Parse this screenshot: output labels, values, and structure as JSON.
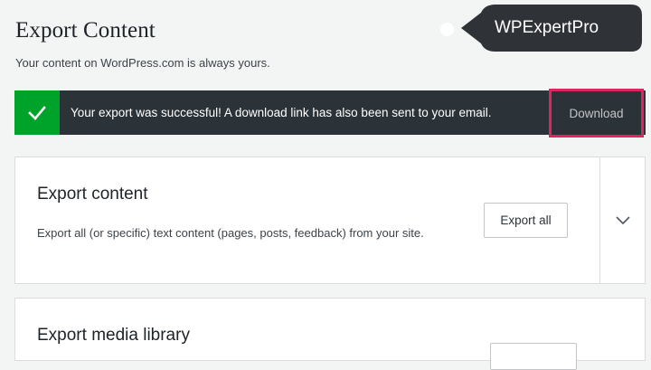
{
  "header": {
    "title": "Export Content",
    "subtitle": "Your content on WordPress.com is always yours."
  },
  "watermark": {
    "text": "WPExpertPro"
  },
  "notice": {
    "status": "success",
    "icon": "checkmark-icon",
    "message": "Your export was successful! A download link has also been sent to your email.",
    "action_label": "Download"
  },
  "cards": [
    {
      "title": "Export content",
      "description": "Export all (or specific) text content (pages, posts, feedback) from your site.",
      "button_label": "Export all",
      "toggle_icon": "chevron-down-icon"
    },
    {
      "title": "Export media library"
    }
  ],
  "colors": {
    "success": "#00a32a",
    "notice_bg": "#2c3338",
    "highlight": "#e0245e",
    "page_bg": "#f3f4f4"
  }
}
